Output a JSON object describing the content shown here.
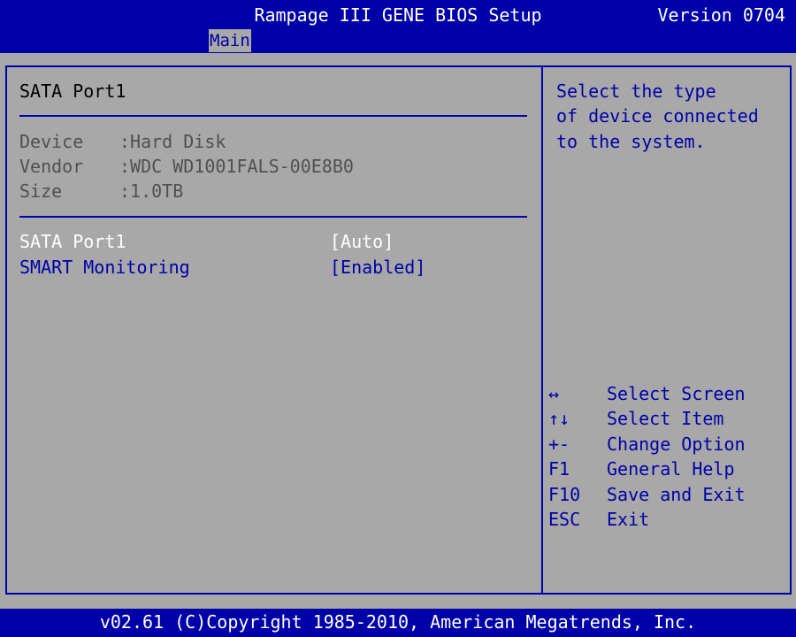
{
  "header": {
    "title": "Rampage III GENE BIOS Setup",
    "version": "Version 0704",
    "tabs": [
      {
        "label": "Main",
        "active": true
      }
    ]
  },
  "main": {
    "section_title": "SATA Port1",
    "info": [
      {
        "label": "Device",
        "value": ":Hard Disk"
      },
      {
        "label": "Vendor",
        "value": ":WDC WD1001FALS-00E8B0"
      },
      {
        "label": "Size",
        "value": ":1.0TB"
      }
    ],
    "options": [
      {
        "label": "SATA Port1",
        "value": "[Auto]",
        "selected": true
      },
      {
        "label": "SMART Monitoring",
        "value": "[Enabled]",
        "selected": false
      }
    ]
  },
  "help": {
    "lines": [
      "Select the type",
      "of device connected",
      "to the system."
    ],
    "keys": [
      {
        "key": "↔",
        "desc": "Select Screen"
      },
      {
        "key": "↑↓",
        "desc": "Select Item"
      },
      {
        "key": "+-",
        "desc": "Change Option"
      },
      {
        "key": "F1",
        "desc": "General Help"
      },
      {
        "key": "F10",
        "desc": "Save and Exit"
      },
      {
        "key": "ESC",
        "desc": "Exit"
      }
    ]
  },
  "footer": {
    "copyright": "v02.61 (C)Copyright 1985-2010, American Megatrends, Inc."
  },
  "colors": {
    "background": "#a8a8a8",
    "accent_blue": "#0000a8",
    "selected_text": "#ffffff",
    "disabled_text": "#505050"
  }
}
